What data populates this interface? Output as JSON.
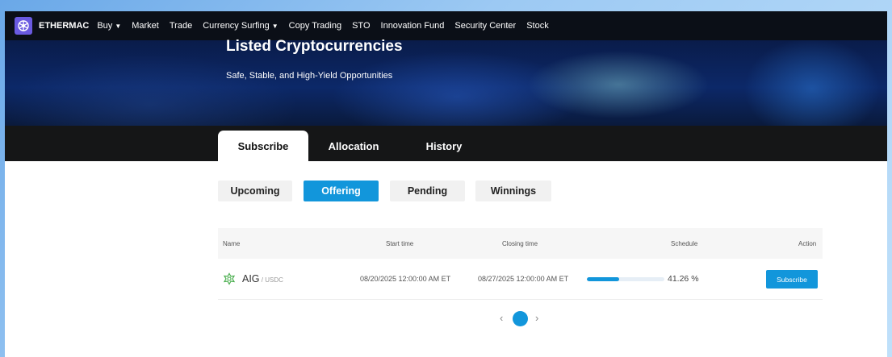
{
  "nav": {
    "brand": "ETHERMAC",
    "items": [
      {
        "label": "Buy",
        "dropdown": true
      },
      {
        "label": "Market",
        "dropdown": false
      },
      {
        "label": "Trade",
        "dropdown": false
      },
      {
        "label": "Currency Surfing",
        "dropdown": true
      },
      {
        "label": "Copy Trading",
        "dropdown": false
      },
      {
        "label": "STO",
        "dropdown": false
      },
      {
        "label": "Innovation Fund",
        "dropdown": false
      },
      {
        "label": "Security Center",
        "dropdown": false
      },
      {
        "label": "Stock",
        "dropdown": false
      }
    ],
    "caret": "▼"
  },
  "banner": {
    "title": "Listed Cryptocurrencies",
    "subtitle": "Safe, Stable, and High-Yield Opportunities"
  },
  "tabs": [
    "Subscribe",
    "Allocation",
    "History"
  ],
  "filters": [
    "Upcoming",
    "Offering",
    "Pending",
    "Winnings"
  ],
  "table": {
    "headers": {
      "name": "Name",
      "start": "Start time",
      "closing": "Closing time",
      "schedule": "Schedule",
      "action": "Action"
    },
    "rows": [
      {
        "coin": "AIG",
        "quote": " / USDC",
        "start": "08/20/2025 12:00:00 AM ET",
        "closing": "08/27/2025 12:00:00 AM ET",
        "progress_percent": 41.26,
        "progress_label": "41.26 %",
        "action_label": "Subscribe"
      }
    ]
  },
  "pagination": {
    "prev": "‹",
    "next": "›",
    "current_page": 1
  },
  "colors": {
    "accent": "#1296db",
    "logo": "#6a5ae0",
    "coin_icon": "#4caf50"
  }
}
